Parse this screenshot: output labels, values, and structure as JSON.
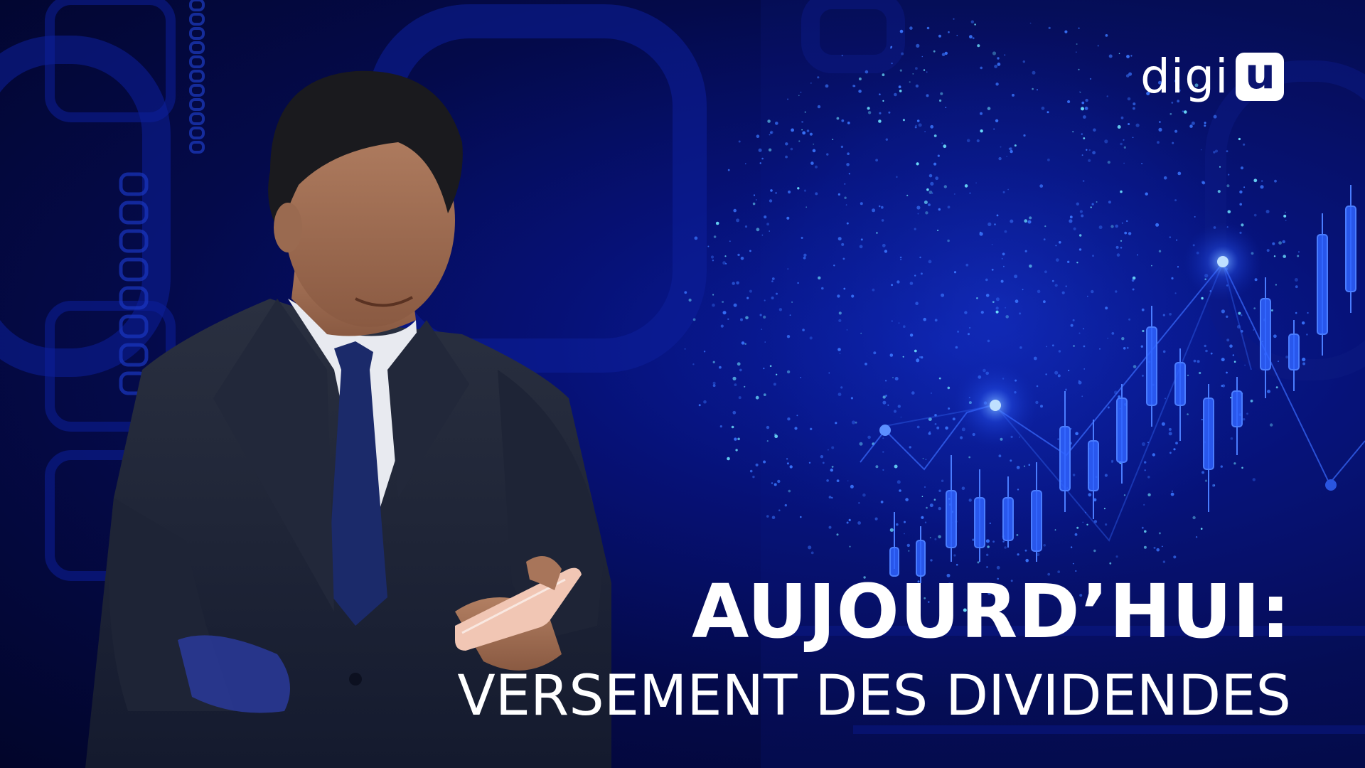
{
  "brand": {
    "logo_text": "digi",
    "logo_mark": "u"
  },
  "headline": "AUJOURD’HUI:",
  "subheadline": "VERSEMENT DES DIVIDENDES",
  "colors": {
    "background": "#040a4a",
    "accent": "#1e50ff",
    "glow": "#4fa3ff",
    "text": "#ffffff"
  },
  "icons": [
    "chain-link-pattern",
    "particle-globe-icon",
    "candlestick-chart-icon",
    "smartphone-icon"
  ]
}
